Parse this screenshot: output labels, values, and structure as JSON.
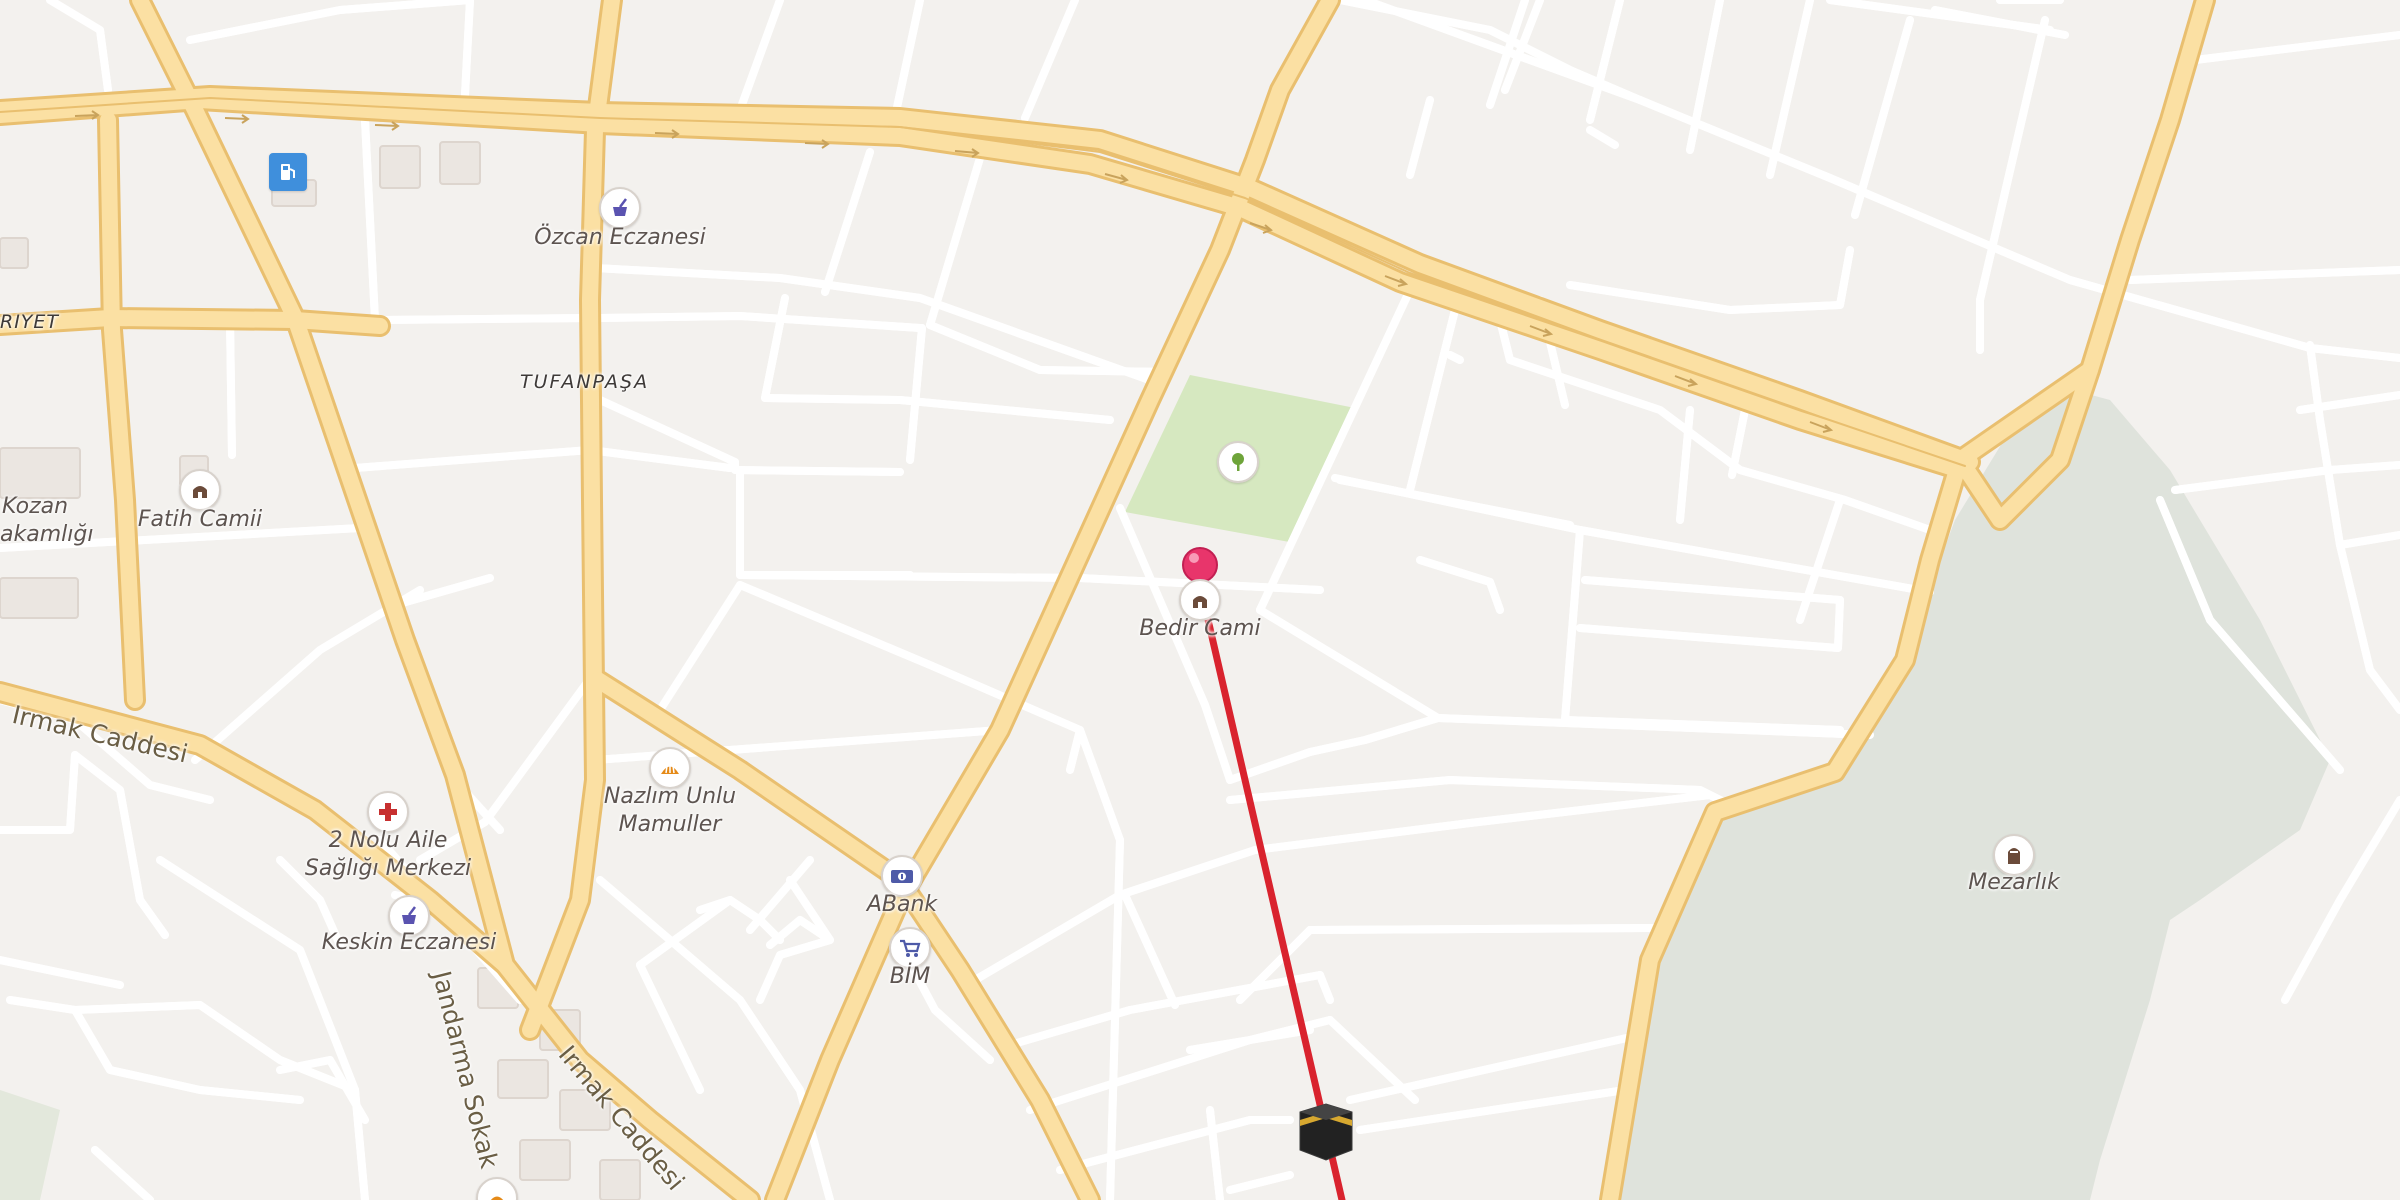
{
  "map": {
    "district_label": "TUFANPAŞA",
    "partial_labels": {
      "left_top": "RIYET",
      "left_mid_1": "Kozan",
      "left_mid_2": "akamlığı"
    },
    "streets": [
      {
        "id": "irmak-1",
        "label": "Irmak Caddesi"
      },
      {
        "id": "irmak-2",
        "label": "Irmak Caddesi"
      },
      {
        "id": "jandarma",
        "label": "Jandarma Sokak"
      }
    ],
    "pois": [
      {
        "id": "fuel",
        "icon": "fuel-station-icon",
        "label": ""
      },
      {
        "id": "ozcan",
        "icon": "pharmacy-icon",
        "label": "Özcan Eczanesi"
      },
      {
        "id": "fatih",
        "icon": "mosque-icon",
        "label": "Fatih Camii"
      },
      {
        "id": "park",
        "icon": "park-tree-icon",
        "label": ""
      },
      {
        "id": "bedir",
        "icon": "mosque-icon",
        "label": "Bedir Cami"
      },
      {
        "id": "nazlim",
        "icon": "bakery-icon",
        "label_line1": "Nazlım Unlu",
        "label_line2": "Mamuller"
      },
      {
        "id": "saglik",
        "icon": "health-center-icon",
        "label_line1": "2 Nolu Aile",
        "label_line2": "Sağlığı Merkezi"
      },
      {
        "id": "abank",
        "icon": "bank-icon",
        "label": "ABank"
      },
      {
        "id": "bim",
        "icon": "supermarket-icon",
        "label": "BİM"
      },
      {
        "id": "keskin",
        "icon": "pharmacy-icon",
        "label": "Keskin Eczanesi"
      },
      {
        "id": "mezarlik",
        "icon": "cemetery-icon",
        "label": "Mezarlık"
      }
    ],
    "pin": {
      "icon": "location-pin-icon"
    },
    "qibla": {
      "icon": "kaaba-icon"
    },
    "colors": {
      "background": "#f3f1ee",
      "road_major_fill": "#fbe0a3",
      "road_major_casing": "#e9bf6f",
      "road_minor": "#ffffff",
      "park": "#d6e8c0",
      "cemetery": "#dfe3dc",
      "qibla_line": "#d9232e",
      "pin": "#e8356b"
    }
  }
}
